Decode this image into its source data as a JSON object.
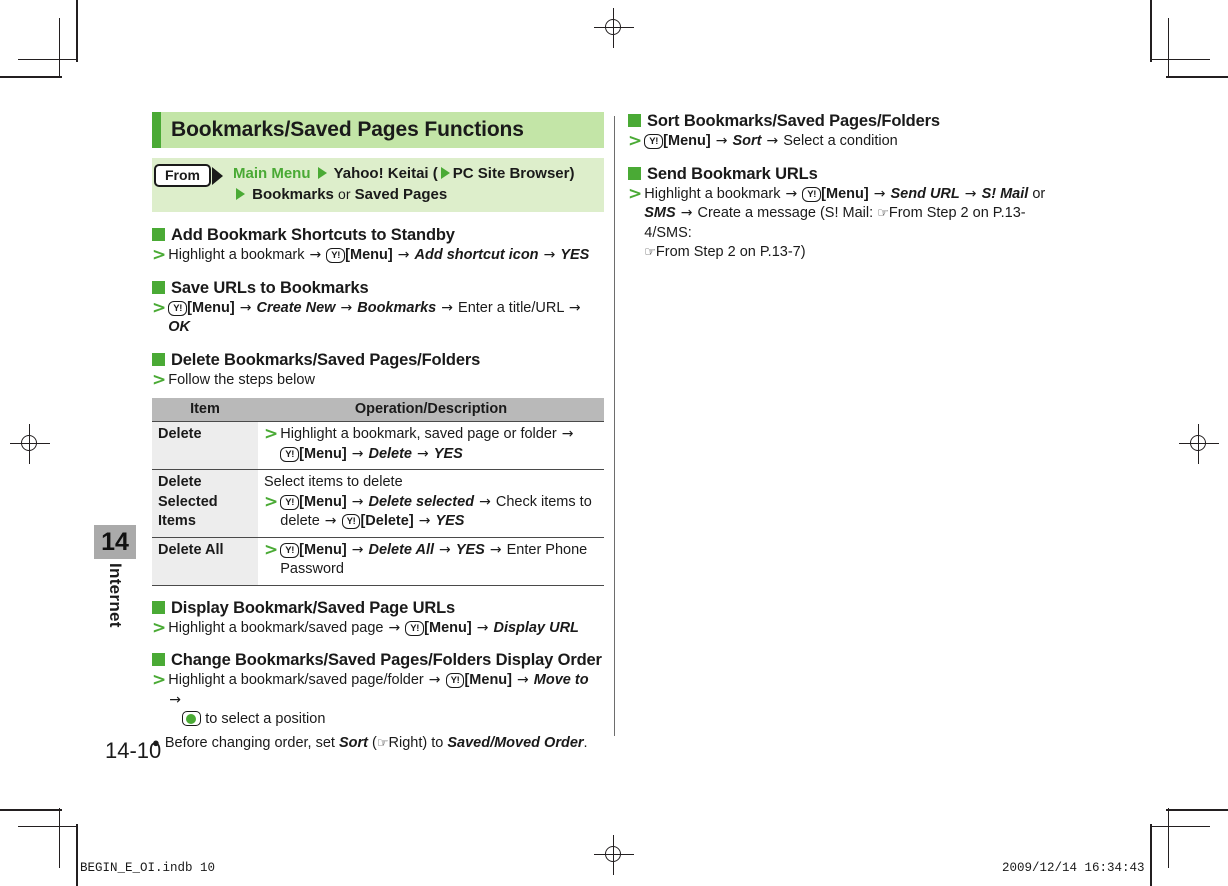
{
  "document": {
    "chapter_number": "14",
    "chapter_name": "Internet",
    "page_number": "14-10",
    "colors": {
      "accent_green": "#4aaa35",
      "header_bg": "#c3e5a7",
      "from_bg": "#ddeecb",
      "table_header_bg": "#b9b9b9",
      "table_item_bg": "#ededed",
      "chapter_tab_bg": "#aaaaaa"
    }
  },
  "header": {
    "title": "Bookmarks/Saved Pages Functions"
  },
  "from": {
    "badge_label": "From",
    "line1_part1": "Main Menu",
    "line1_part2": "Yahoo! Keitai (",
    "line1_part3": "PC Site Browser)",
    "line2_part1": "Bookmarks",
    "line2_or": "or",
    "line2_part2": "Saved Pages"
  },
  "left_column": {
    "sections": [
      {
        "heading": "Add Bookmark Shortcuts to Standby",
        "step_prefix": "Highlight a bookmark",
        "key_label": "[Menu]",
        "item1": "Add shortcut icon",
        "item2": "YES"
      },
      {
        "heading": "Save URLs to Bookmarks",
        "key_label": "[Menu]",
        "item1": "Create New",
        "item2": "Bookmarks",
        "plain1": "Enter a title/URL",
        "item3": "OK"
      },
      {
        "heading": "Delete Bookmarks/Saved Pages/Folders",
        "step_text": "Follow the steps below"
      }
    ],
    "table": {
      "headers": [
        "Item",
        "Operation/Description"
      ],
      "rows": [
        {
          "item": "Delete",
          "desc_line1": "Highlight a bookmark, saved page or folder",
          "desc_key": "[Menu]",
          "desc_item1": "Delete",
          "desc_item2": "YES"
        },
        {
          "item": "Delete\nSelected Items",
          "desc_intro": "Select items to delete",
          "desc_key": "[Menu]",
          "desc_item1": "Delete selected",
          "desc_plain1": "Check items to delete",
          "desc_key2": "[Delete]",
          "desc_item2": "YES"
        },
        {
          "item": "Delete All",
          "desc_key": "[Menu]",
          "desc_item1": "Delete All",
          "desc_item2": "YES",
          "desc_plain1": "Enter Phone Password"
        }
      ]
    },
    "sections_after": [
      {
        "heading": "Display Bookmark/Saved Page URLs",
        "step_prefix": "Highlight a bookmark/saved page",
        "key_label": "[Menu]",
        "item1": "Display URL"
      },
      {
        "heading": "Change Bookmarks/Saved Pages/Folders Display Order",
        "step_prefix": "Highlight a bookmark/saved page/folder",
        "key_label": "[Menu]",
        "item1": "Move to",
        "nav_suffix": "to select a position",
        "note_pre": "Before changing order, set",
        "note_italic1": "Sort",
        "note_ref": "Right",
        "note_mid": ") to",
        "note_italic2": "Saved/Moved Order",
        "note_end": "."
      }
    ]
  },
  "right_column": {
    "sections": [
      {
        "heading": "Sort Bookmarks/Saved Pages/Folders",
        "key_label": "[Menu]",
        "item1": "Sort",
        "plain1": "Select a condition"
      },
      {
        "heading": "Send Bookmark URLs",
        "step_prefix": "Highlight a bookmark",
        "key_label": "[Menu]",
        "item1": "Send URL",
        "item2": "S! Mail",
        "or_text": "or",
        "item3": "SMS",
        "plain1": "Create a message (S! Mail:",
        "ref1": "From Step 2 on P.13-4/SMS:",
        "ref2": "From Step 2 on P.13-7)"
      }
    ]
  },
  "footer": {
    "slug_file": "BEGIN_E_OI.indb   10",
    "slug_date": "2009/12/14   16:34:43"
  },
  "icons": {
    "y_key": "Y!",
    "arrow": "→",
    "hand": "☞",
    "gt": ">"
  }
}
